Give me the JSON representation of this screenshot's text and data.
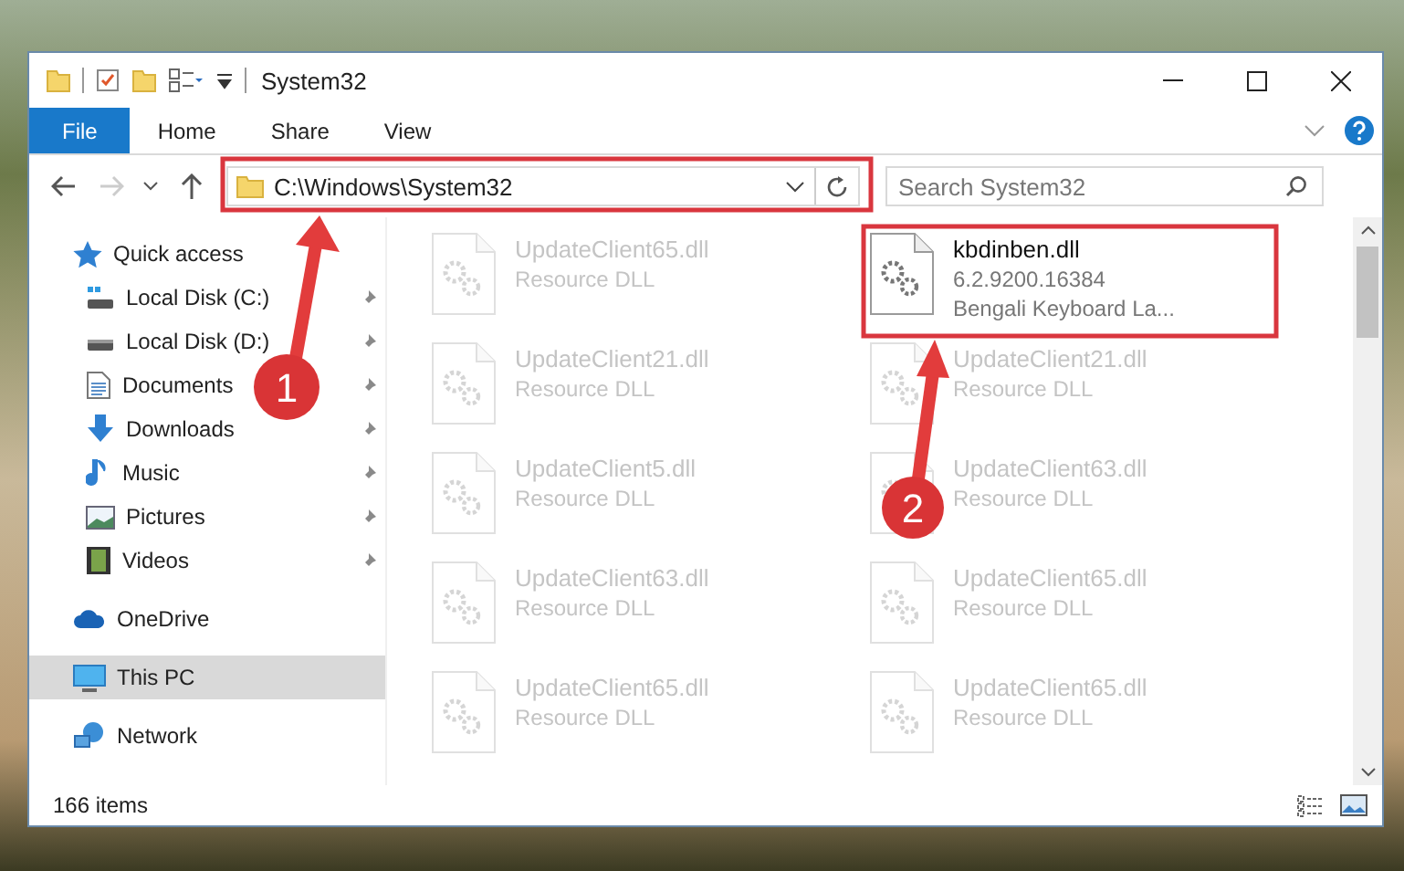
{
  "window": {
    "title": "System32"
  },
  "ribbon_tabs": [
    {
      "label": "File",
      "selected": true
    },
    {
      "label": "Home",
      "selected": false
    },
    {
      "label": "Share",
      "selected": false
    },
    {
      "label": "View",
      "selected": false
    }
  ],
  "address_bar": {
    "path": "C:\\Windows\\System32",
    "callout": "1"
  },
  "search": {
    "placeholder": "Search System32"
  },
  "sidebar": {
    "sections": [
      {
        "label": "Quick access",
        "kind": "star",
        "selected": false,
        "children": [
          {
            "label": "Local Disk (C:)",
            "kind": "disk-c",
            "pinned": true
          },
          {
            "label": "Local Disk (D:)",
            "kind": "disk",
            "pinned": true
          },
          {
            "label": "Documents",
            "kind": "documents",
            "pinned": true
          },
          {
            "label": "Downloads",
            "kind": "downloads",
            "pinned": true
          },
          {
            "label": "Music",
            "kind": "music",
            "pinned": true
          },
          {
            "label": "Pictures",
            "kind": "pictures",
            "pinned": true
          },
          {
            "label": "Videos",
            "kind": "videos",
            "pinned": true
          }
        ]
      },
      {
        "label": "OneDrive",
        "kind": "cloud",
        "selected": false
      },
      {
        "label": "This PC",
        "kind": "pc",
        "selected": true
      },
      {
        "label": "Network",
        "kind": "network",
        "selected": false
      }
    ]
  },
  "files": [
    {
      "name": "UpdateClient65.dll",
      "details": [
        "Resource DLL"
      ],
      "faded": true
    },
    {
      "name": "UpdateClient21.dll",
      "details": [
        "Resource DLL"
      ],
      "faded": true
    },
    {
      "name": "UpdateClient5.dll",
      "details": [
        "Resource DLL"
      ],
      "faded": true
    },
    {
      "name": "UpdateClient63.dll",
      "details": [
        "Resource DLL"
      ],
      "faded": true
    },
    {
      "name": "UpdateClient65.dll",
      "details": [
        "Resource DLL"
      ],
      "faded": true
    },
    {
      "name": "kbdinben.dll",
      "details": [
        "6.2.9200.16384",
        "Bengali Keyboard La..."
      ],
      "faded": false,
      "callout": "2"
    },
    {
      "name": "UpdateClient21.dll",
      "details": [
        "Resource DLL"
      ],
      "faded": true
    },
    {
      "name": "UpdateClient63.dll",
      "details": [
        "Resource DLL"
      ],
      "faded": true
    },
    {
      "name": "UpdateClient65.dll",
      "details": [
        "Resource DLL"
      ],
      "faded": true
    },
    {
      "name": "UpdateClient65.dll",
      "details": [
        "Resource DLL"
      ],
      "faded": true
    }
  ],
  "status_bar": {
    "item_count": "166 items"
  }
}
